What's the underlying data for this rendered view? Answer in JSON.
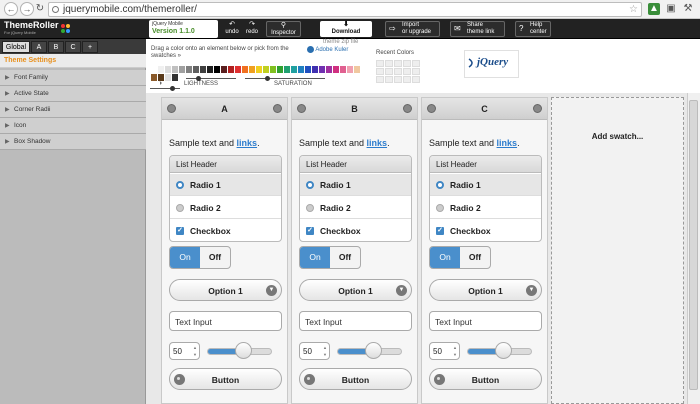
{
  "browser": {
    "url": "jquerymobile.com/themeroller/",
    "back_icon": "back-arrow-icon",
    "forward_icon": "forward-arrow-icon"
  },
  "toolbar": {
    "logo": "ThemeRoller",
    "logo_sub": "For jQuery Mobile",
    "version_top": "jQuery Mobile",
    "version": "Version 1.1.0",
    "undo": "undo",
    "redo": "redo",
    "inspector": "Inspector",
    "download": "Download",
    "download_sub": "theme zip file",
    "import": "Import",
    "import_sub": "or upgrade",
    "share": "Share",
    "share_sub": "theme link",
    "help": "Help",
    "help_sub": "center"
  },
  "tabs": [
    "Global",
    "A",
    "B",
    "C",
    "+"
  ],
  "panel": {
    "title": "Theme Settings",
    "items": [
      "Font Family",
      "Active State",
      "Corner Radii",
      "Icon",
      "Box Shadow"
    ]
  },
  "colorpicker": {
    "instructions": "Drag a color onto an element below or pick from the swatches »",
    "kuler": "Adobe Kuler",
    "lightness": "LIGHTNESS",
    "saturation": "SATURATION",
    "recent": "Recent Colors",
    "brand": "jQuery",
    "colors": [
      "#ffffff",
      "#f0f0f0",
      "#dcdcdc",
      "#c0c0c0",
      "#a0a0a0",
      "#808080",
      "#606060",
      "#404040",
      "#202020",
      "#000000",
      "#5a1f1f",
      "#b02020",
      "#e03030",
      "#f07020",
      "#f0a020",
      "#f0d020",
      "#c0d020",
      "#80c020",
      "#30a030",
      "#20a070",
      "#20a0a0",
      "#2080c0",
      "#2050c0",
      "#4030b0",
      "#7030b0",
      "#a030a0",
      "#d03080",
      "#e06090",
      "#f0a0b0",
      "#f0c8a0"
    ],
    "colors2": [
      "#8a5a2a",
      "#5a3a1a",
      "#e0e0e0",
      "#333333"
    ]
  },
  "swatches": [
    {
      "letter": "A"
    },
    {
      "letter": "B"
    },
    {
      "letter": "C"
    }
  ],
  "sample": {
    "text": "Sample text and ",
    "link": "links",
    "period": ".",
    "list_header": "List Header",
    "radio1": "Radio 1",
    "radio2": "Radio 2",
    "checkbox": "Checkbox",
    "on": "On",
    "off": "Off",
    "select": "Option 1",
    "input_placeholder": "Text Input",
    "number": "50",
    "slider_value": 0.55,
    "button": "Button"
  },
  "add_swatch": "Add swatch..."
}
